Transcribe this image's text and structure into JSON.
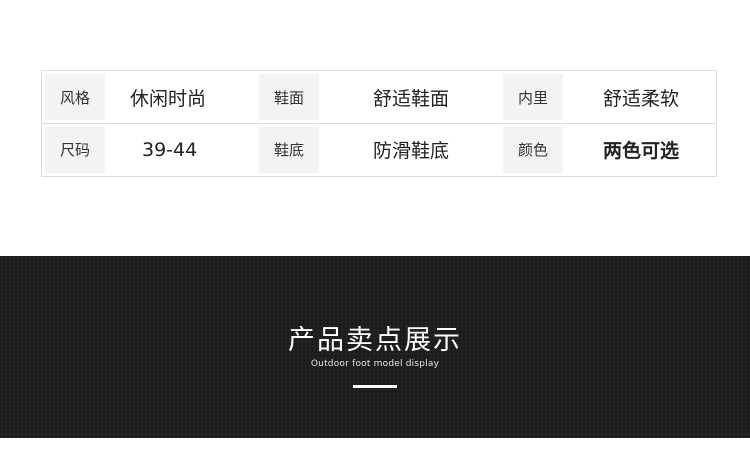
{
  "spec_table": {
    "rows": [
      [
        {
          "label": "风格",
          "value": "休闲时尚"
        },
        {
          "label": "鞋面",
          "value": "舒适鞋面"
        },
        {
          "label": "内里",
          "value": "舒适柔软"
        }
      ],
      [
        {
          "label": "尺码",
          "value": "39-44"
        },
        {
          "label": "鞋底",
          "value": "防滑鞋底"
        },
        {
          "label": "颜色",
          "value": "两色可选"
        }
      ]
    ]
  },
  "banner": {
    "title": "产品卖点展示",
    "subtitle": "Outdoor foot model display"
  },
  "colors": {
    "banner_bg": "#1c1c1c",
    "label_bg": "#f3f3f3",
    "border": "#dcdcdc"
  }
}
